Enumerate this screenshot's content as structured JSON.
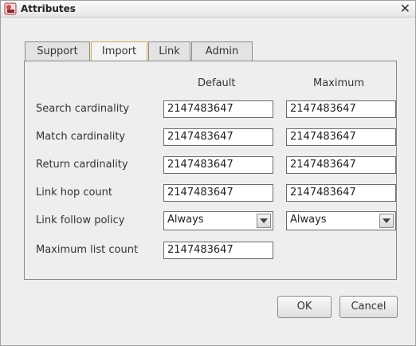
{
  "window": {
    "title": "Attributes"
  },
  "icons": {
    "app": "app-icon",
    "close": "close-icon",
    "dropdown": "chevron-down-icon"
  },
  "tabs": [
    {
      "label": "Support"
    },
    {
      "label": "Import",
      "active": true
    },
    {
      "label": "Link"
    },
    {
      "label": "Admin"
    }
  ],
  "columns": {
    "default": "Default",
    "maximum": "Maximum"
  },
  "rows": [
    {
      "label": "Search cardinality",
      "default": "2147483647",
      "maximum": "2147483647"
    },
    {
      "label": "Match cardinality",
      "default": "2147483647",
      "maximum": "2147483647"
    },
    {
      "label": "Return cardinality",
      "default": "2147483647",
      "maximum": "2147483647"
    },
    {
      "label": "Link hop count",
      "default": "2147483647",
      "maximum": "2147483647"
    },
    {
      "label": "Link follow policy",
      "default": "Always",
      "maximum": "Always"
    },
    {
      "label": "Maximum list count",
      "default": "2147483647"
    }
  ],
  "buttons": {
    "ok": "OK",
    "cancel": "Cancel"
  },
  "colors": {
    "active_tab_border": "#d4a94a",
    "background": "#eeeeee"
  }
}
